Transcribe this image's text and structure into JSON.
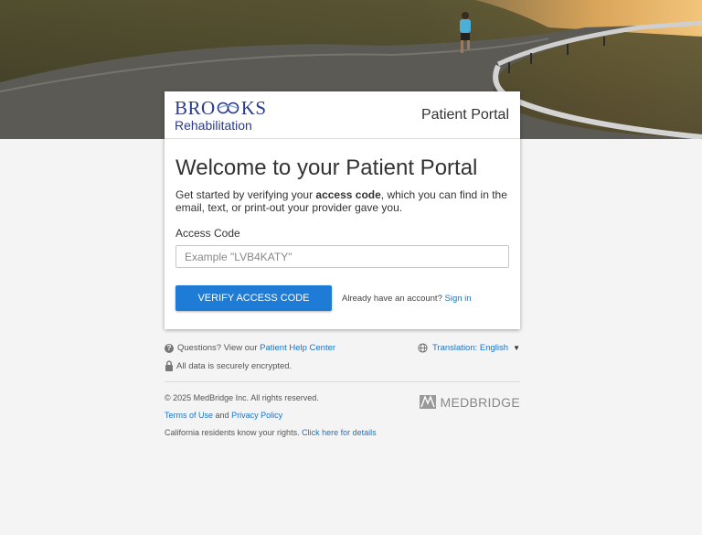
{
  "header": {
    "logo_top": "BRO",
    "logo_top_end": "KS",
    "logo_bottom": "Rehabilitation",
    "portal_title": "Patient Portal"
  },
  "card": {
    "welcome": "Welcome to your Patient Portal",
    "intro_pre": "Get started by verifying your ",
    "intro_bold": "access code",
    "intro_post": ", which you can find in the email, text, or print-out your provider gave you.",
    "access_label": "Access Code",
    "access_value": "",
    "access_placeholder": "Example \"LVB4KATY\"",
    "verify_button": "VERIFY ACCESS CODE",
    "signin_prompt": "Already have an account?",
    "signin_link": "Sign in"
  },
  "help": {
    "question_text": "Questions? View our",
    "help_link": "Patient Help Center",
    "translation": "Translation: English",
    "secure_text": "All data is securely encrypted."
  },
  "footer": {
    "copyright": "© 2025 MedBridge Inc. All rights reserved.",
    "terms_link": "Terms of Use",
    "and_text": "and",
    "privacy_link": "Privacy Policy",
    "california_text": "California residents know your rights.",
    "california_link": "Click here for details",
    "brand": "MEDBRIDGE"
  },
  "colors": {
    "brand_blue": "#2b3b8c",
    "button_blue": "#1e7bd6",
    "link_blue": "#1a73c8",
    "background": "#f4f4f4"
  },
  "icons": [
    "question-icon",
    "globe-icon",
    "caret-down-icon",
    "lock-icon",
    "medbridge-logo-icon"
  ]
}
